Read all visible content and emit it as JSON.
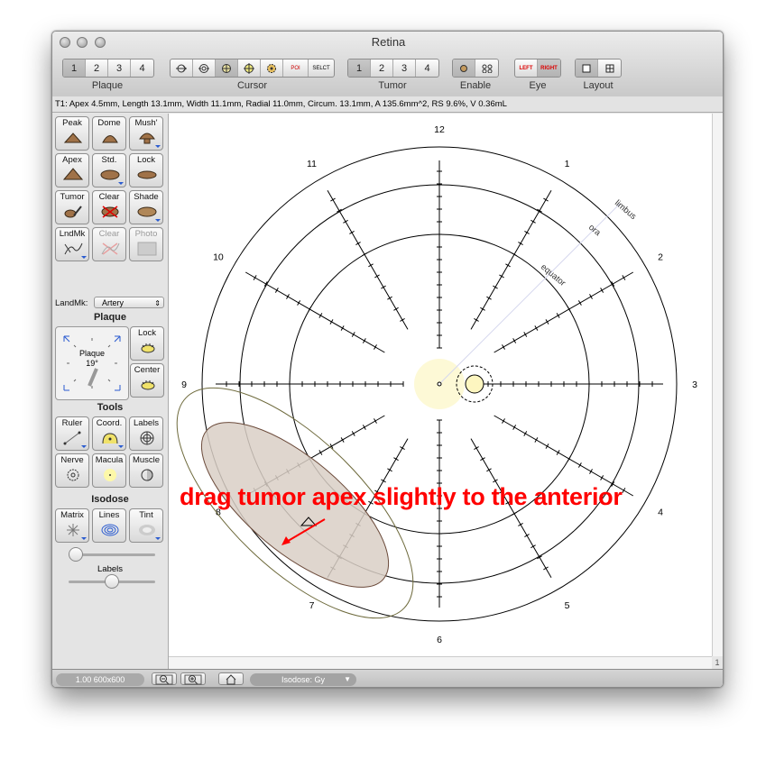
{
  "window": {
    "title": "Retina"
  },
  "toolbar": {
    "plaque": {
      "label": "Plaque",
      "buttons": [
        "1",
        "2",
        "3",
        "4"
      ]
    },
    "cursor": {
      "label": "Cursor",
      "tool_icons": [
        "crosshair-arrow-icon",
        "target-icon",
        "plaque-cursor-icon",
        "move-icon",
        "gear-icon",
        "poi-icon",
        "select-icon"
      ],
      "poi_text": "POI",
      "select_text": "SELCT"
    },
    "tumor": {
      "label": "Tumor",
      "buttons": [
        "1",
        "2",
        "3",
        "4"
      ]
    },
    "enable": {
      "label": "Enable"
    },
    "eye": {
      "label": "Eye",
      "left": "LEFT",
      "right": "RIGHT"
    },
    "layout": {
      "label": "Layout"
    }
  },
  "info_text": "T1: Apex 4.5mm, Length 13.1mm, Width 11.1mm, Radial 11.0mm, Circum. 13.1mm, A 135.6mm^2, RS 9.6%, V 0.36mL",
  "sidebar": {
    "tools_top": [
      "Peak",
      "Dome",
      "Mush'",
      "Apex",
      "Std.",
      "Lock",
      "Tumor",
      "Clear",
      "Shade",
      "LndMk",
      "Clear",
      "Photo"
    ],
    "landmark_label": "LandMk:",
    "landmark_value": "Artery",
    "plaque_section": "Plaque",
    "plaque_widget_label": "Plaque",
    "plaque_angle": "19°",
    "plaque_lock": "Lock",
    "plaque_center": "Center",
    "tools_section": "Tools",
    "tools": [
      "Ruler",
      "Coord.",
      "Labels",
      "Nerve",
      "Macula",
      "Muscle"
    ],
    "isodose_section": "Isodose",
    "isodose_tools": [
      "Matrix",
      "Lines",
      "Tint"
    ],
    "slider_label": "Labels",
    "slider1_value": 0.08,
    "slider2_value": 0.5
  },
  "chart": {
    "clock_labels": [
      "12",
      "1",
      "2",
      "3",
      "4",
      "5",
      "6",
      "7",
      "8",
      "9",
      "10",
      "11"
    ],
    "ring_labels": [
      "limbus",
      "ora",
      "equator"
    ],
    "annotation": "drag tumor apex slightly to the anterior"
  },
  "statusbar": {
    "zoom": "1.00 600x600",
    "isodose": "Isodose: Gy",
    "page": "1"
  },
  "colors": {
    "annotation": "#ff0000",
    "tumor_fill": "#d9cfc6",
    "plaque_outline": "#6e6a3c"
  }
}
